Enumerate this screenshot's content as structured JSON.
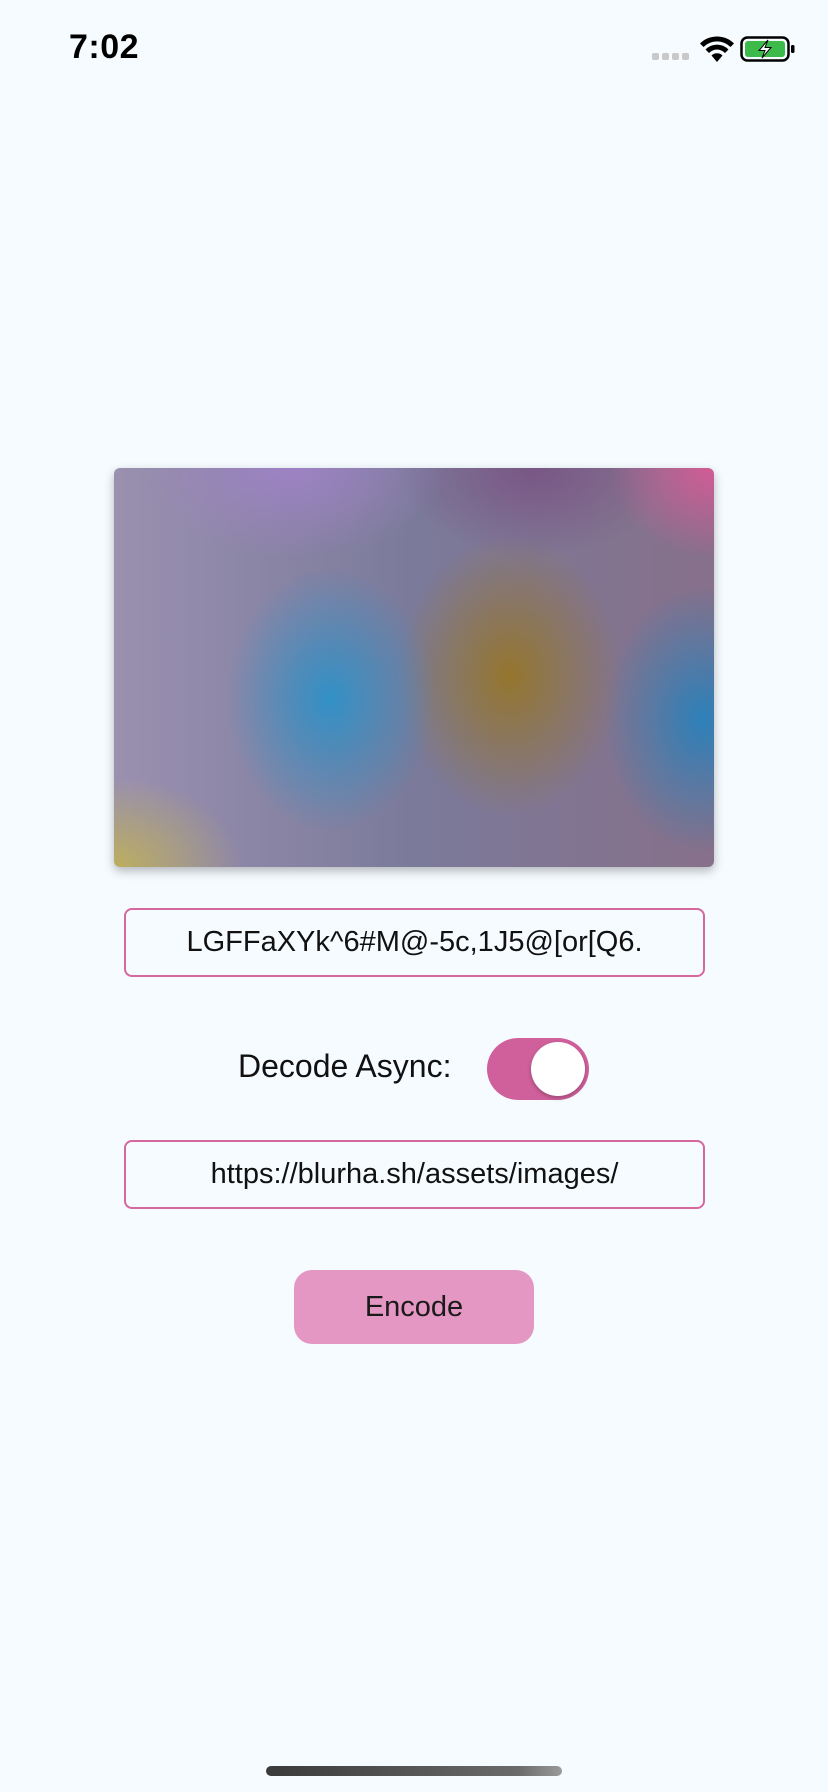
{
  "status_bar": {
    "time": "7:02",
    "signal_icon": "cellular-signal-icon",
    "wifi_icon": "wifi-icon",
    "battery_icon": "battery-charging-icon",
    "battery_color": "#3dbb4a"
  },
  "preview": {
    "icon": "blurhash-preview-image"
  },
  "hash_input": {
    "value": "LGFFaXYk^6#M@-5c,1J5@[or[Q6."
  },
  "decode_async": {
    "label": "Decode Async:",
    "enabled": true,
    "accent_color": "#d0609b"
  },
  "url_input": {
    "value": "https://blurha.sh/assets/images/"
  },
  "encode_button": {
    "label": "Encode",
    "color": "#e497c2"
  },
  "colors": {
    "background": "#f5fbff",
    "field_border": "#d4699d"
  }
}
